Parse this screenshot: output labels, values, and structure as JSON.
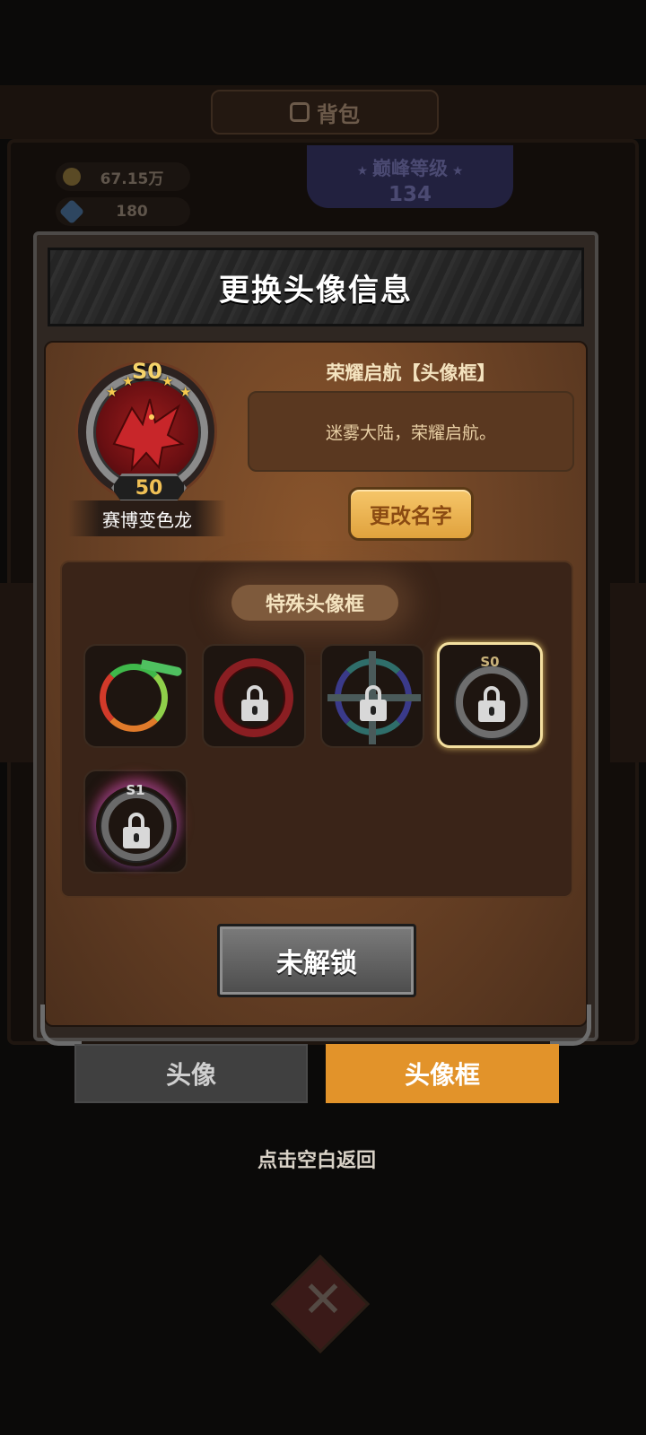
{
  "background": {
    "title": "背包",
    "title_icon": "bag-icon",
    "resources": [
      {
        "icon": "gold-coin-icon",
        "value": "67.15万"
      },
      {
        "icon": "gem-icon",
        "value": "180"
      }
    ],
    "peak_level": {
      "label": "巅峰等级",
      "value": "134"
    }
  },
  "panel": {
    "title": "更换头像信息"
  },
  "avatar": {
    "rank": "S0",
    "level": "50",
    "name": "赛博变色龙",
    "portrait": "red-dragon-icon"
  },
  "frame_info": {
    "title": "荣耀启航【头像框】",
    "description": "迷雾大陆，荣耀启航。",
    "rename_label": "更改名字"
  },
  "frames": {
    "header": "特殊头像框",
    "items": [
      {
        "icon": "serpent-ring-frame-icon",
        "locked": false,
        "selected": false,
        "rank": ""
      },
      {
        "icon": "crimson-ring-frame-icon",
        "locked": true,
        "selected": false,
        "rank": ""
      },
      {
        "icon": "spiked-teal-frame-icon",
        "locked": true,
        "selected": false,
        "rank": ""
      },
      {
        "icon": "silver-ring-frame-icon",
        "locked": true,
        "selected": true,
        "rank": "S0"
      },
      {
        "icon": "aurora-ring-frame-icon",
        "locked": true,
        "selected": false,
        "rank": "S1"
      }
    ]
  },
  "action_button": "未解锁",
  "tabs": [
    {
      "label": "头像",
      "active": false
    },
    {
      "label": "头像框",
      "active": true
    }
  ],
  "hint": "点击空白返回",
  "colors": {
    "accent_orange": "#e2932a",
    "gold_button": "#f6c66a",
    "selected_border": "#f4e0a0"
  }
}
